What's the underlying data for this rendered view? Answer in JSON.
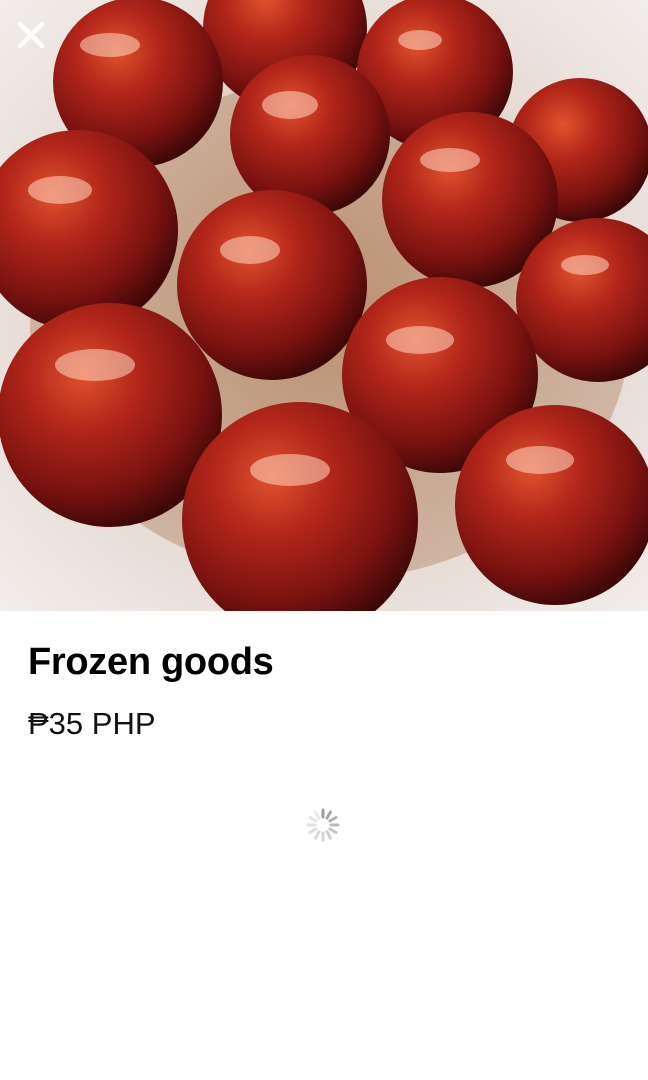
{
  "listing": {
    "title": "Frozen goods",
    "price": "₱35 PHP"
  },
  "photo": {
    "description_icon": "food-photo"
  },
  "toolbar": {
    "close_icon": "close-icon"
  },
  "loading": {
    "icon": "spinner-icon"
  },
  "colors": {
    "background": "#ffffff",
    "text": "#000000",
    "close_icon": "#ffffff",
    "spinner": "#9e9e9e"
  }
}
